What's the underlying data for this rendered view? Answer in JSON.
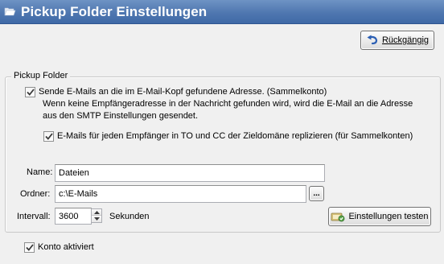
{
  "window": {
    "title": "Pickup Folder Einstellungen",
    "title_icon": "folder-open-icon",
    "titlebar_color": "#4f77b0"
  },
  "toolbar": {
    "undo_label": "Rückgängig",
    "undo_icon": "undo-arrow-icon"
  },
  "group": {
    "legend": "Pickup Folder",
    "send_to_header_address": {
      "checked": true,
      "label": "Sende E-Mails an die im E-Mail-Kopf gefundene Adresse. (Sammelkonto)",
      "hint_line1": "Wenn keine Empfängeradresse in der Nachricht gefunden wird, wird die E-Mail an die Adresse",
      "hint_line2": "aus den SMTP Einstellungen gesendet."
    },
    "replicate": {
      "checked": true,
      "label": "E-Mails für jeden Empfänger in TO und CC der Zieldomäne replizieren (für Sammelkonten)"
    },
    "name": {
      "label": "Name:",
      "value": "Dateien"
    },
    "folder": {
      "label": "Ordner:",
      "value": "c:\\E-Mails",
      "browse_label": "..."
    },
    "interval": {
      "label": "Intervall:",
      "value": "3600",
      "unit": "Sekunden"
    },
    "test_button": {
      "label": "Einstellungen testen",
      "icon": "settings-test-icon"
    }
  },
  "account": {
    "checked": true,
    "label": "Konto aktiviert"
  }
}
